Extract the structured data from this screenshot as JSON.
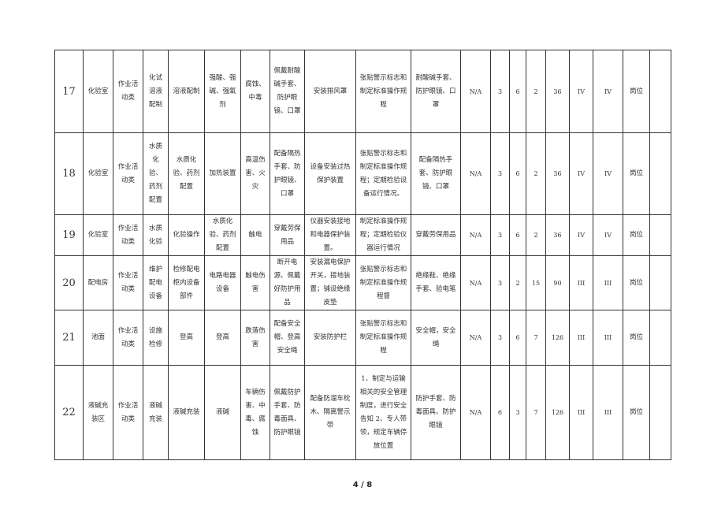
{
  "table": {
    "rows": [
      {
        "no": "17",
        "cells": [
          "化验室",
          "作业活动类",
          "化试溶液配制",
          "溶液配制",
          "强酸、强碱、强氧剂",
          "腐蚀、中毒",
          "佩戴耐酸碱手套、防护眼镜、口罩",
          "安装排风罩",
          "张贴警示标志和制定标准操作规程",
          "耐酸碱手套、防护眼镜、口罩",
          "N/A",
          "3",
          "6",
          "2",
          "36",
          "IV",
          "IV",
          "岗位",
          ""
        ]
      },
      {
        "no": "18",
        "cells": [
          "化验室",
          "作业活动类",
          "水质化验、药剂配置",
          "水质化验、药剂配置",
          "加热装置",
          "高温伤害、火灾",
          "配备隔热手套、防护眼镜、口罩",
          "设备安装过热保护装置",
          "张贴警示标志和制定标准操作规程；定期检验设备运行情况。",
          "配备隔热手套、防护眼镜、口罩",
          "N/A",
          "3",
          "6",
          "2",
          "36",
          "IV",
          "IV",
          "岗位",
          ""
        ]
      },
      {
        "no": "19",
        "cells": [
          "化验室",
          "作业活动类",
          "水质化验",
          "化验操作",
          "水质化验、药剂配置",
          "触电",
          "穿戴劳保用品",
          "仪器安装接地和电器保护装置。",
          "制定标准操作规程；定期检验仪器运行情况",
          "穿戴劳保用品",
          "N/A",
          "3",
          "6",
          "2",
          "36",
          "IV",
          "IV",
          "岗位",
          ""
        ]
      },
      {
        "no": "20",
        "cells": [
          "配电房",
          "作业活动类",
          "维护配电设备",
          "检修配电柜内设备部件",
          "电路电器设备",
          "触电伤害",
          "断开电源、佩戴好防护用品",
          "安装漏电保护开关，接地装置；铺设绝缘皮垫",
          "张贴警示标志和制定标准操作规程督",
          "绝缘鞋、绝缘手套、验电笔",
          "N/A",
          "3",
          "2",
          "15",
          "90",
          "III",
          "III",
          "岗位",
          ""
        ]
      },
      {
        "no": "21",
        "cells": [
          "池面",
          "作业活动类",
          "设施检修",
          "登高",
          "登高",
          "跌落伤害",
          "配备安全帽、登高安全绳",
          "安装防护栏",
          "张贴警示标志和制定标准操作规程",
          "安全帽，安全绳",
          "N/A",
          "3",
          "6",
          "7",
          "126",
          "III",
          "III",
          "岗位",
          ""
        ]
      },
      {
        "no": "22",
        "cells": [
          "液碱充装区",
          "作业活动类",
          "液碱充装",
          "液碱充装",
          "液碱",
          "车辆伤害、中毒、腐蚀",
          "佩戴防护手套、防毒面具、防护眼镜",
          "配备防溜车枕木、隔离警示带",
          "1、制定与运输相关的安全管理制度，进行安全告知 2、专人带领，规定车辆停放位置",
          "防护手套、防毒面具、防护眼镜",
          "N/A",
          "6",
          "3",
          "7",
          "126",
          "III",
          "III",
          "岗位",
          ""
        ]
      }
    ]
  },
  "footer": {
    "page": "4 / 8"
  }
}
